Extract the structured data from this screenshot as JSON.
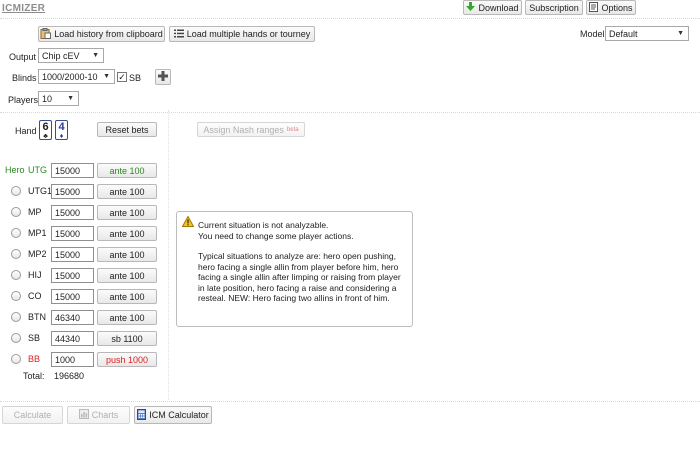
{
  "app": {
    "title": "ICMIZER"
  },
  "topbar": {
    "download_label": "Download",
    "subscription_label": "Subscription",
    "options_label": "Options"
  },
  "toolbar": {
    "load_history_label": "Load history from clipboard",
    "load_multiple_label": "Load multiple hands or tourney"
  },
  "model": {
    "label": "Model",
    "value": "Default"
  },
  "settings": {
    "output_label": "Output",
    "output_value": "Chip cEV",
    "blinds_label": "Blinds",
    "blinds_value": "1000/2000-10",
    "sb_label": "SB",
    "sb_checked": true,
    "players_label": "Players",
    "players_value": "10"
  },
  "hand": {
    "label": "Hand",
    "cards": [
      {
        "rank": "6",
        "suit": "♣"
      },
      {
        "rank": "4",
        "suit": "♦"
      }
    ],
    "reset_label": "Reset bets",
    "nash_label": "Assign Nash ranges",
    "nash_badge": "beta"
  },
  "players": [
    {
      "name": "UTG",
      "stack": "15000",
      "action": "ante 100",
      "hero": true
    },
    {
      "name": "UTG1",
      "stack": "15000",
      "action": "ante 100"
    },
    {
      "name": "MP",
      "stack": "15000",
      "action": "ante 100"
    },
    {
      "name": "MP1",
      "stack": "15000",
      "action": "ante 100"
    },
    {
      "name": "MP2",
      "stack": "15000",
      "action": "ante 100"
    },
    {
      "name": "HIJ",
      "stack": "15000",
      "action": "ante 100"
    },
    {
      "name": "CO",
      "stack": "15000",
      "action": "ante 100"
    },
    {
      "name": "BTN",
      "stack": "46340",
      "action": "ante 100"
    },
    {
      "name": "SB",
      "stack": "44340",
      "action": "sb 1100"
    },
    {
      "name": "BB",
      "stack": "1000",
      "action": "push 1000",
      "highlight": true
    }
  ],
  "hero_label": "Hero",
  "total": {
    "label": "Total:",
    "value": "196680"
  },
  "message": {
    "line1": "Current situation is not analyzable.",
    "line2": "You need to change some player actions.",
    "body": "Typical situations to analyze are: hero open pushing, hero facing a single allin from player before him, hero facing a single allin after limping or raising from player in late position, hero facing a raise and considering a resteal. NEW: Hero facing two allins in front of him."
  },
  "bottom": {
    "calculate_label": "Calculate",
    "charts_label": "Charts",
    "icm_label": "ICM Calculator"
  },
  "colors": {
    "hero_green": "#2a8a1f",
    "bb_red": "#e02020",
    "nash_badge": "#e08a8a"
  }
}
